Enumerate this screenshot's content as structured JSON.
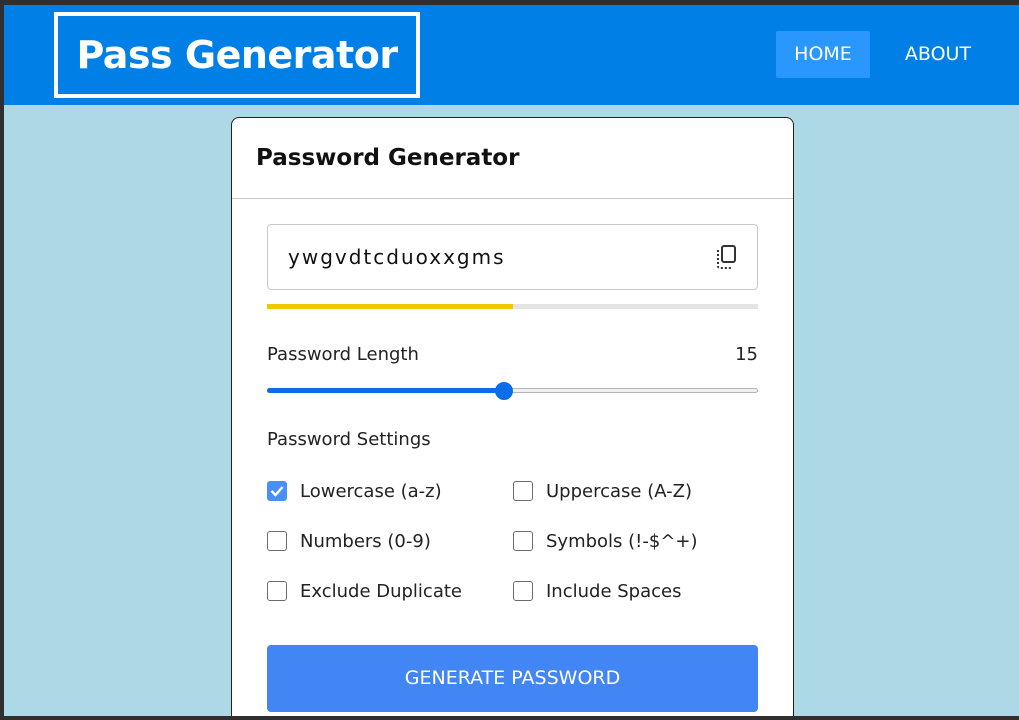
{
  "brand": {
    "title": "Pass Generator"
  },
  "nav": {
    "home": "HOME",
    "about": "ABOUT"
  },
  "card": {
    "title": "Password Generator",
    "password": "ywgvdtcduoxxgms",
    "strength_fraction": 0.5,
    "length_label": "Password Length",
    "length_value": "15",
    "slider": {
      "min": 1,
      "max": 30,
      "value": 15
    },
    "settings_label": "Password Settings",
    "options": {
      "lowercase": {
        "label": "Lowercase (a-z)",
        "checked": true
      },
      "uppercase": {
        "label": "Uppercase (A-Z)",
        "checked": false
      },
      "numbers": {
        "label": "Numbers (0-9)",
        "checked": false
      },
      "symbols": {
        "label": "Symbols (!-$^+)",
        "checked": false
      },
      "exclude_duplicate": {
        "label": "Exclude Duplicate",
        "checked": false
      },
      "include_spaces": {
        "label": "Include Spaces",
        "checked": false
      }
    },
    "generate_label": "GENERATE PASSWORD"
  },
  "icons": {
    "copy": "copy-icon",
    "check": "check-icon"
  },
  "colors": {
    "navbar": "#0080e6",
    "nav_active": "#2a97ff",
    "background": "#add8e6",
    "accent": "#4285f4",
    "slider": "#0a6fe6",
    "strength": "#f0c800"
  }
}
